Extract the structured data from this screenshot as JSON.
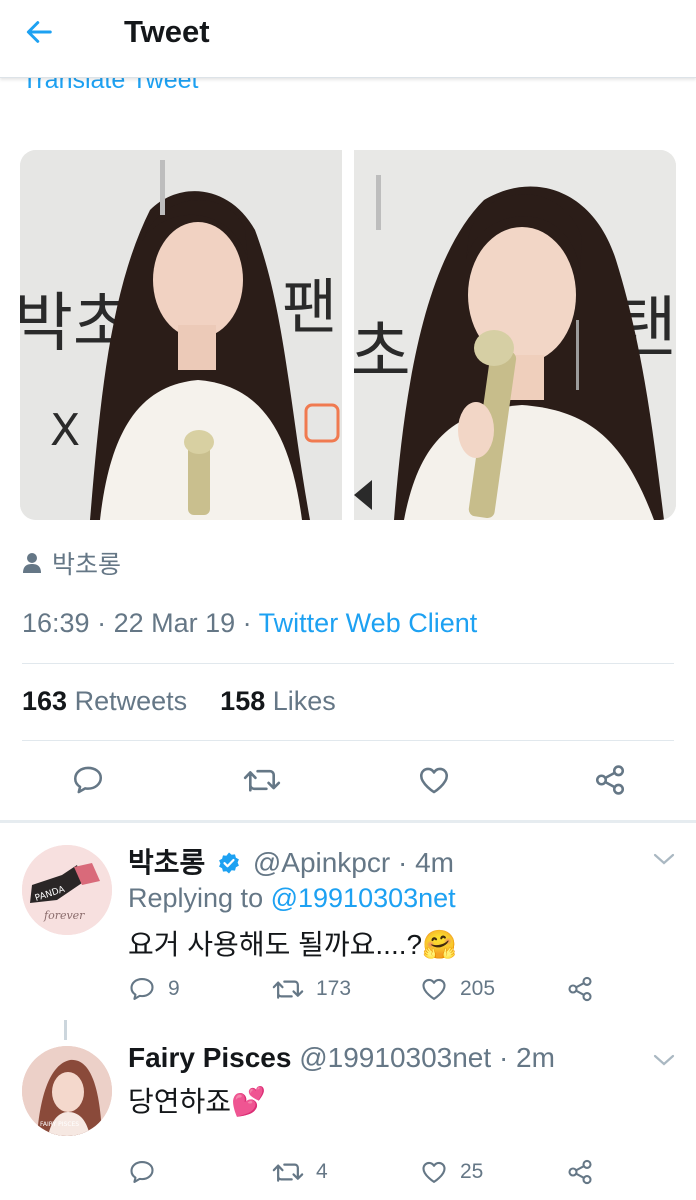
{
  "header": {
    "title": "Tweet"
  },
  "tweet": {
    "translate_label": "Translate Tweet",
    "tagged_user": "박초롱",
    "time": "16:39",
    "date": "22 Mar 19",
    "separator": " · ",
    "client": "Twitter Web Client",
    "retweets_count": "163",
    "retweets_label": "Retweets",
    "likes_count": "158",
    "likes_label": "Likes"
  },
  "replies": [
    {
      "name": "박초롱",
      "verified": true,
      "handle": "@Apinkpcr",
      "time": " · 4m",
      "replying_prefix": "Replying to ",
      "replying_to": "@19910303net",
      "text": "요거 사용해도 될까요....?🤗",
      "reply_count": "9",
      "retweet_count": "173",
      "like_count": "205"
    },
    {
      "name": "Fairy Pisces",
      "handle": "@19910303net",
      "time": " · 2m",
      "text": "당연하죠💕",
      "reply_count": "",
      "retweet_count": "4",
      "like_count": "25"
    }
  ],
  "colors": {
    "accent": "#1da1f2",
    "secondary_text": "#657786",
    "divider": "#e1e8ed"
  },
  "icons": [
    "back-arrow-icon",
    "reply-icon",
    "retweet-icon",
    "like-icon",
    "share-icon",
    "verified-icon",
    "chevron-down-icon",
    "person-icon"
  ]
}
